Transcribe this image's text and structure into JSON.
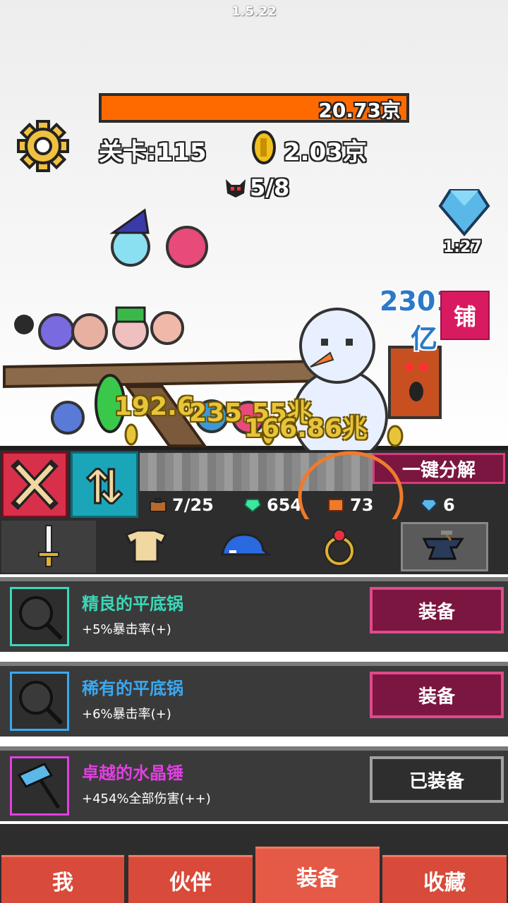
{
  "version": "1.5.22",
  "hud": {
    "boss_hp_text": "20.73京",
    "boss_hp_fraction": 1.0,
    "stage_label": "关卡:115",
    "gold": "2.03京",
    "wave": "5/8",
    "gem_timer": "1:27",
    "damage_popup": "2301",
    "damage_popup_suffix": "亿",
    "shop_label": "铺"
  },
  "battle_damage": [
    "192.6",
    "235.55兆",
    "166.86兆"
  ],
  "resources": {
    "bag": "7/25",
    "green_gem": "654",
    "orange_block": "73",
    "diamond": "6",
    "decompose_label": "一键分解"
  },
  "tabs": [
    {
      "name": "sword",
      "icon": "sword-icon"
    },
    {
      "name": "armor",
      "icon": "armor-icon"
    },
    {
      "name": "hat",
      "icon": "cap-icon"
    },
    {
      "name": "ring",
      "icon": "ring-icon"
    },
    {
      "name": "forge",
      "icon": "anvil-icon"
    }
  ],
  "items": [
    {
      "name": "精良的平底锅",
      "desc": "+5%暴击率(+)",
      "button": "装备",
      "state": "equip",
      "color": "#3ad8b8",
      "icon": "frying-pan-icon"
    },
    {
      "name": "稀有的平底锅",
      "desc": "+6%暴击率(+)",
      "button": "装备",
      "state": "equip",
      "color": "#3aa8f0",
      "icon": "frying-pan-icon"
    },
    {
      "name": "卓越的水晶锤",
      "desc": "+454%全部伤害(++)",
      "button": "已装备",
      "state": "equipped",
      "color": "#e040e0",
      "icon": "crystal-hammer-icon"
    }
  ],
  "nav": [
    "我",
    "伙伴",
    "装备",
    "收藏"
  ],
  "colors": {
    "hp": "#ff6a00",
    "accent": "#d81b60",
    "nav": "#d84a3a",
    "highlight_circle": "#f07a2a"
  }
}
